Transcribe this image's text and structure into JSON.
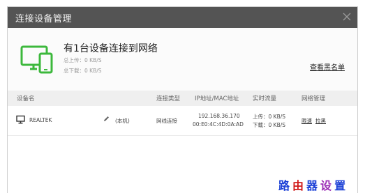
{
  "window": {
    "title": "连接设备管理"
  },
  "summary": {
    "headline": "有1台设备连接到网络",
    "upload": "总上传：0 KB/S",
    "download": "总下载：0 KB/S",
    "blacklist_link": "查看黑名单",
    "accent_color": "#3cb83c"
  },
  "table": {
    "headers": {
      "device": "设备名",
      "type": "连接类型",
      "address": "IP地址/MAC地址",
      "traffic": "实时流量",
      "manage": "网络管理"
    },
    "rows": [
      {
        "name": "REALTEK",
        "tag": "(本机)",
        "type": "网线连接",
        "ip": "192.168.36.170",
        "mac": "00:E0:4C:4D:0A:AD",
        "upload": "上传：0 KB/S",
        "download": "下载：0 KB/S",
        "limit": "限速",
        "block": "拉黑"
      }
    ]
  },
  "watermark": {
    "c1": "路",
    "c2": "由",
    "c3": "器",
    "c4": "设",
    "c5": "置"
  }
}
